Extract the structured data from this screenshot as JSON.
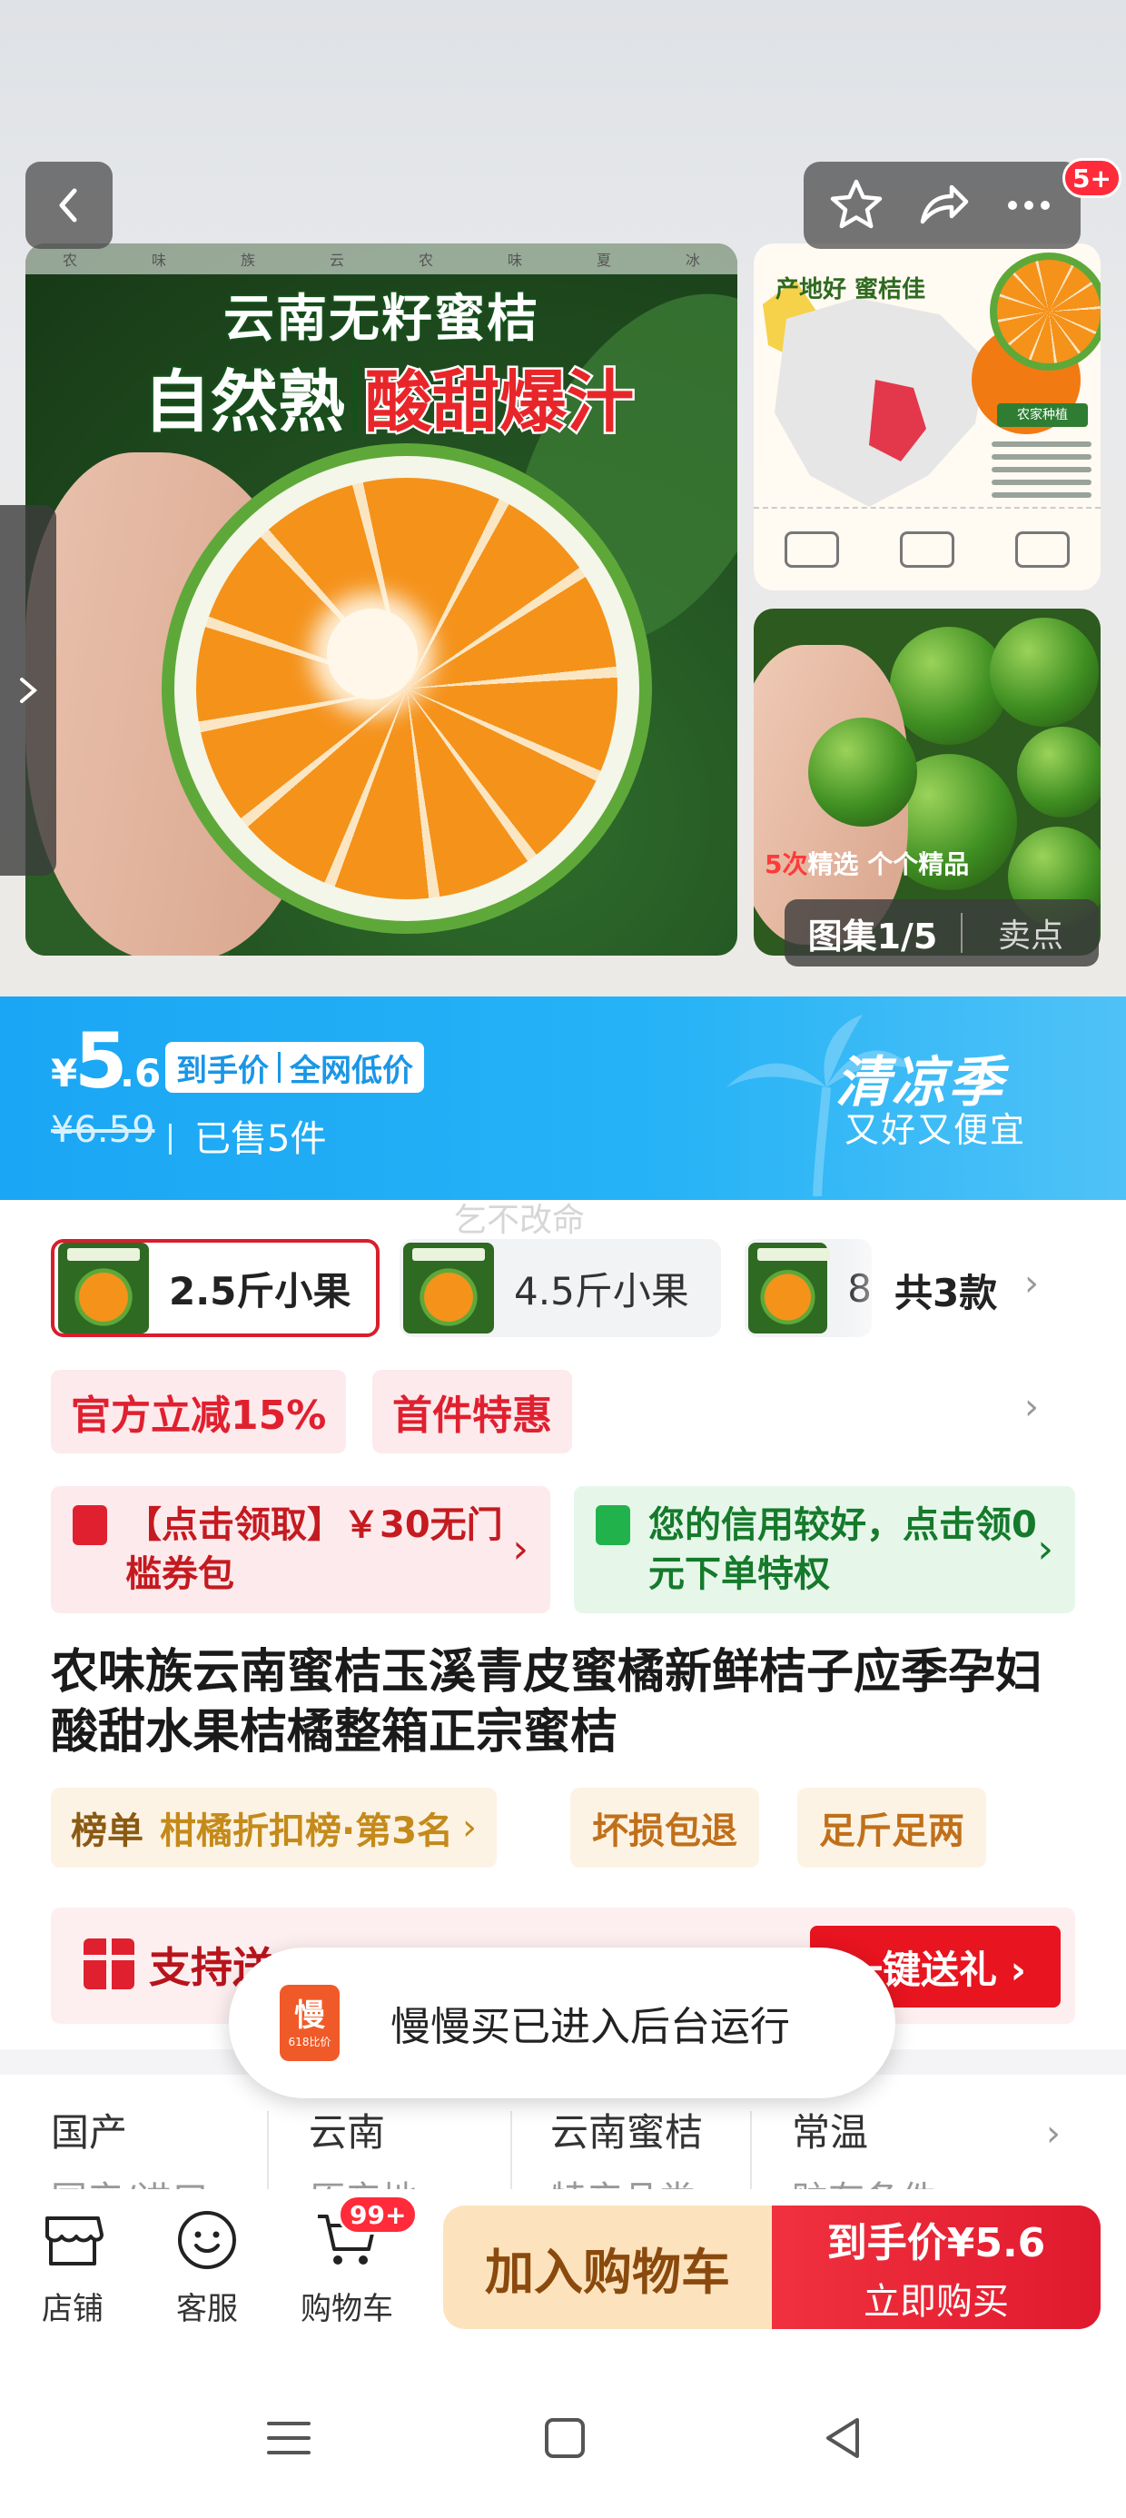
{
  "gallery": {
    "image_strip_chars": [
      "农",
      "味",
      "族",
      "云",
      "农",
      "味",
      "夏",
      "冰"
    ],
    "main_image_title": "云南无籽蜜桔",
    "main_image_banner_left": "自然熟",
    "main_image_banner_right": "酸甜爆汁",
    "thumb1_title": "产地好 蜜桔佳",
    "thumb1_tag": "农家种植",
    "thumb2_caption_num": "5次",
    "thumb2_caption_text": "精选 个个精品",
    "counter": "图集1/5",
    "selling_points": "卖点",
    "notification_badge": "5+"
  },
  "price": {
    "currency": "¥",
    "integer": "5",
    "decimal": ".6",
    "tag_left": "到手价",
    "tag_right": "全网低价",
    "original": "¥6.59",
    "sold": "已售5件",
    "season_title": "清凉季",
    "season_sub": "又好又便宜"
  },
  "watermark": "乞不改命",
  "sku": {
    "options": [
      {
        "label": "2.5斤小果"
      },
      {
        "label": "4.5斤小果"
      },
      {
        "label": "8"
      }
    ],
    "count_label": "共3款"
  },
  "promos": {
    "discount": "官方立减15%",
    "first_order": "首件特惠"
  },
  "coupons": {
    "red_text": "【点击领取】￥30无门槛券包",
    "green_text": "您的信用较好，点击领0元下单特权"
  },
  "product_title": "农味族云南蜜桔玉溪青皮蜜橘新鲜桔子应季孕妇酸甜水果桔橘整箱正宗蜜桔",
  "tags": {
    "rank_label": "榜单",
    "rank_value": "柑橘折扣榜·第3名",
    "rank_arrow": "›",
    "tag1": "坏损包退",
    "tag2": "足斤足两"
  },
  "gift": {
    "text": "支持送",
    "button": "一键送礼 ›"
  },
  "toast": {
    "logo_char": "慢",
    "logo_sub": "618比价",
    "message": "慢慢买已进入后台运行"
  },
  "attributes": [
    {
      "value": "国产",
      "key": "国产/进口"
    },
    {
      "value": "云南",
      "key": "原产地"
    },
    {
      "value": "云南蜜桔",
      "key": "特产品类"
    },
    {
      "value": "常温",
      "key": "贮存条件"
    }
  ],
  "actionbar": {
    "shop": "店铺",
    "service": "客服",
    "cart": "购物车",
    "cart_badge": "99+",
    "add_to_cart": "加入购物车",
    "buy_line1": "到手价¥5.6",
    "buy_line2": "立即购买"
  },
  "colors": {
    "brand_red": "#e8141f",
    "price_blue": "#1aa6f4",
    "cart_orange": "#fde3bd"
  }
}
